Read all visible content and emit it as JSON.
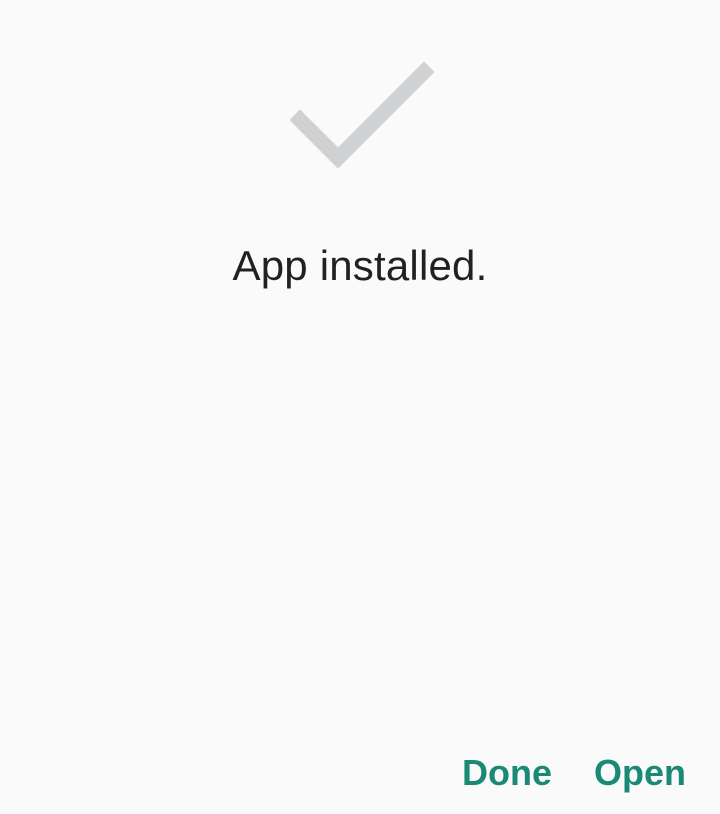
{
  "dialog": {
    "icon": "checkmark-icon",
    "message": "App installed."
  },
  "actions": {
    "done_label": "Done",
    "open_label": "Open"
  },
  "colors": {
    "background": "#fafafa",
    "checkmark": "#cfd1d3",
    "text": "#212121",
    "accent": "#1a8a77"
  }
}
